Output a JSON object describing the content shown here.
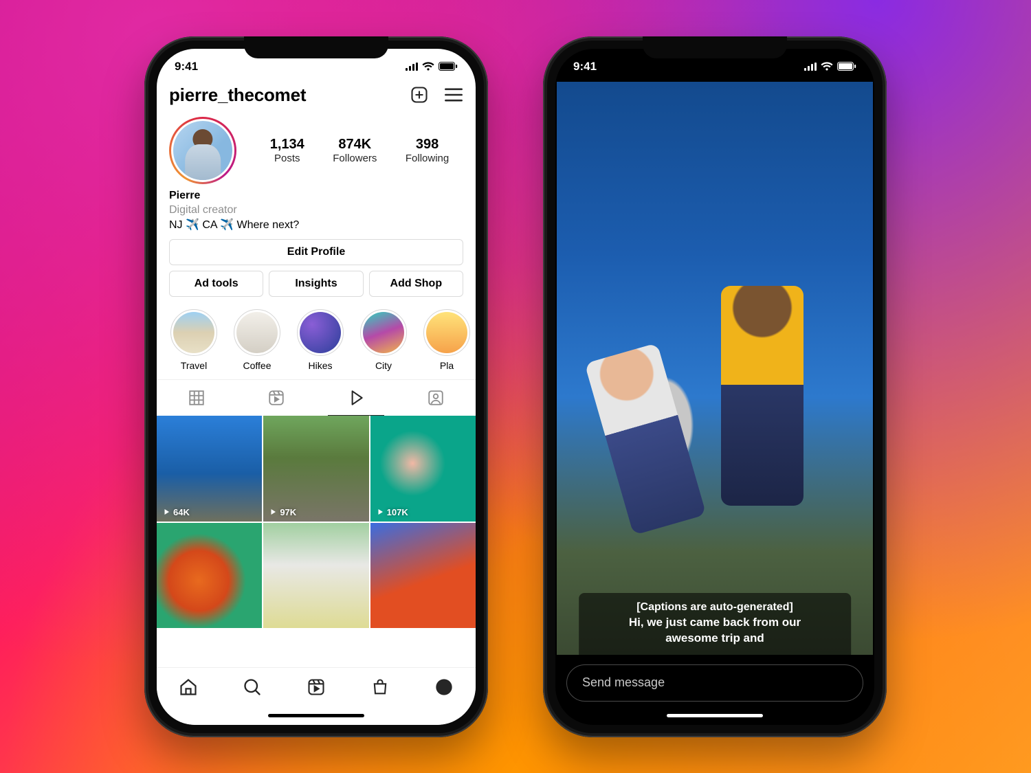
{
  "status": {
    "time": "9:41"
  },
  "profile": {
    "username": "pierre_thecomet",
    "stats": {
      "posts": {
        "value": "1,134",
        "label": "Posts"
      },
      "followers": {
        "value": "874K",
        "label": "Followers"
      },
      "following": {
        "value": "398",
        "label": "Following"
      }
    },
    "name": "Pierre",
    "category": "Digital creator",
    "bio_line": "NJ ✈️ CA ✈️ Where next?",
    "buttons": {
      "edit": "Edit Profile",
      "adtools": "Ad tools",
      "insights": "Insights",
      "addshop": "Add Shop"
    },
    "highlights": [
      {
        "label": "Travel"
      },
      {
        "label": "Coffee"
      },
      {
        "label": "Hikes"
      },
      {
        "label": "City"
      },
      {
        "label": "Pla"
      }
    ],
    "grid_views": [
      "64K",
      "97K",
      "107K"
    ]
  },
  "video": {
    "caption_tag": "[Captions are auto-generated]",
    "caption_line1": "Hi, we just came back from our",
    "caption_line2": "awesome trip and",
    "message_placeholder": "Send message"
  }
}
